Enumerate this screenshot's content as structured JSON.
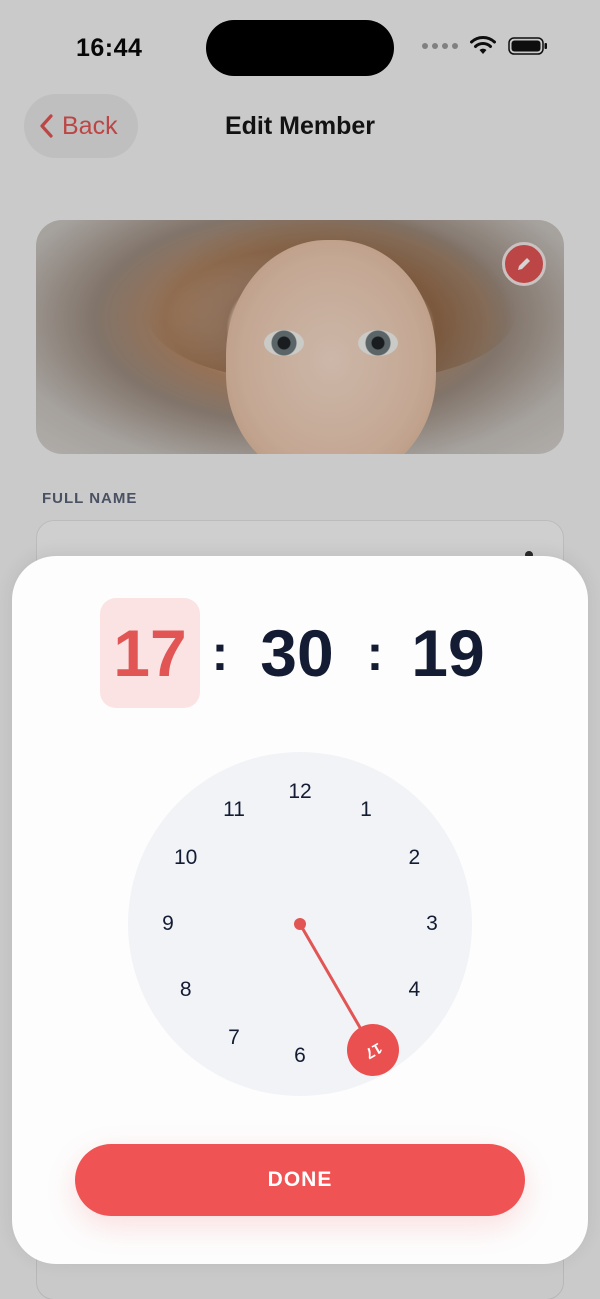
{
  "status_bar": {
    "time": "16:44"
  },
  "nav": {
    "back_label": "Back",
    "title": "Edit Member"
  },
  "form": {
    "full_name_label": "FULL NAME",
    "full_name_value": ""
  },
  "time_picker": {
    "hours": "17",
    "minutes": "30",
    "seconds": "19",
    "active_segment": "hours",
    "separator": ":",
    "dial_numbers": [
      "12",
      "1",
      "2",
      "3",
      "4",
      "5",
      "6",
      "7",
      "8",
      "9",
      "10",
      "11"
    ],
    "selected_dial_value": "17",
    "done_label": "DONE"
  },
  "colors": {
    "accent": "#ef5353",
    "active_bg": "#fbe3e3",
    "text_dark": "#141c33"
  },
  "icons": [
    "chevron-left-icon",
    "pencil-icon",
    "wifi-icon",
    "battery-icon",
    "signal-icon"
  ]
}
